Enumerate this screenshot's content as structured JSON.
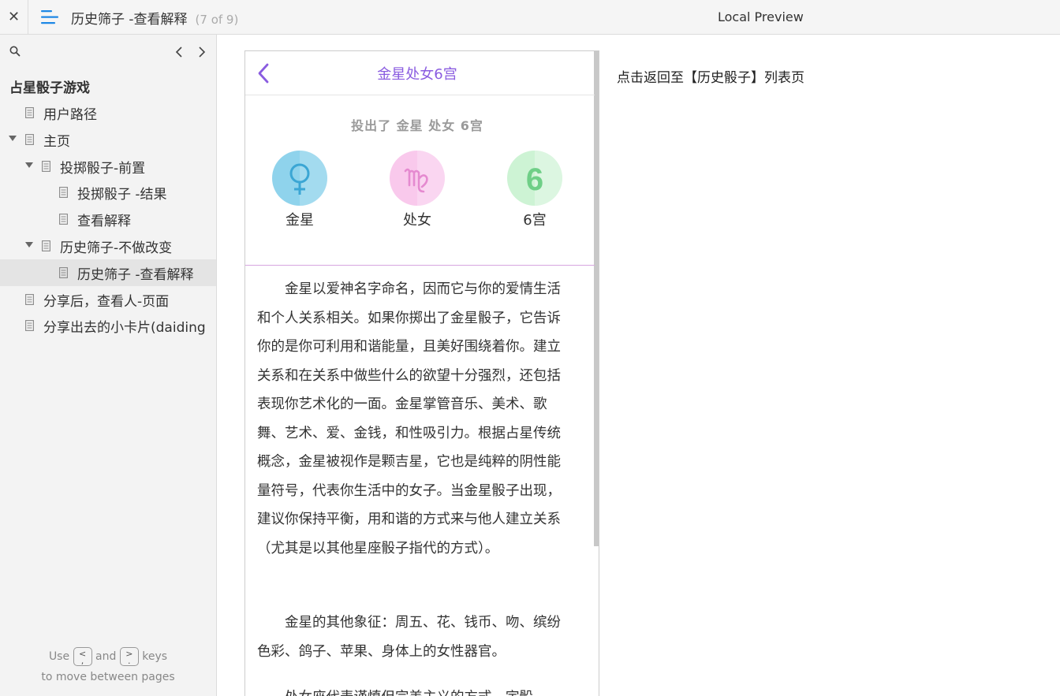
{
  "topbar": {
    "close_symbol": "✕",
    "page_title": "历史筛子 -查看解释",
    "page_count": "(7 of 9)",
    "preview_label": "Local Preview"
  },
  "sidebar": {
    "tree_title": "占星骰子游戏",
    "items": [
      {
        "label": "用户路径",
        "level": 1,
        "expanded": null,
        "selected": false
      },
      {
        "label": "主页",
        "level": 1,
        "expanded": true,
        "selected": false
      },
      {
        "label": "投掷骰子-前置",
        "level": 2,
        "expanded": true,
        "selected": false
      },
      {
        "label": "投掷骰子 -结果",
        "level": 3,
        "expanded": null,
        "selected": false
      },
      {
        "label": "查看解释",
        "level": 3,
        "expanded": null,
        "selected": false
      },
      {
        "label": "历史筛子-不做改变",
        "level": 2,
        "expanded": true,
        "selected": false
      },
      {
        "label": "历史筛子 -查看解释",
        "level": 3,
        "expanded": null,
        "selected": true
      },
      {
        "label": "分享后，查看人-页面",
        "level": 1,
        "expanded": null,
        "selected": false
      },
      {
        "label": "分享出去的小卡片(daiding",
        "level": 1,
        "expanded": null,
        "selected": false
      }
    ],
    "hint": {
      "use": "Use",
      "key_prev": "<",
      "and": "and",
      "key_next": ">",
      "keys": "keys",
      "line2": "to move between pages"
    }
  },
  "phone": {
    "title": "金星处女6宫",
    "roll_text": "投出了  金星  处女  6宫",
    "dice": [
      {
        "label": "金星",
        "symbol": "venus",
        "color": "#8fd3ec",
        "glyph_color": "#3ba6d4"
      },
      {
        "label": "处女",
        "symbol": "virgo",
        "color": "#f9c9ec",
        "glyph_color": "#e58ad0"
      },
      {
        "label": "6宫",
        "symbol": "6",
        "color": "#cdf3d4",
        "glyph_color": "#6fcf87"
      }
    ],
    "paragraphs": [
      "金星以爱神名字命名，因而它与你的爱情生活和个人关系相关。如果你掷出了金星骰子，它告诉你的是你可利用和谐能量，且美好围绕着你。建立关系和在关系中做些什么的欲望十分强烈，还包括表现你艺术化的一面。金星掌管音乐、美术、歌舞、艺术、爱、金钱，和性吸引力。根据占星传统概念，金星被视作是颗吉星，它也是纯粹的阴性能量符号，代表你生活中的女子。当金星骰子出现，建议你保持平衡，用和谐的方式来与他人建立关系（尤其是以其他星座骰子指代的方式）。",
      "金星的其他象征：周五、花、钱币、吻、缤纷色彩、鸽子、苹果、身体上的女性器官。",
      "处女座代表谨慎但完美主义的方式。宇骰"
    ]
  },
  "annotation": "点击返回至【历史骰子】列表页",
  "colors": {
    "accent": "#8a5ce0",
    "menu_icon": "#1e88e5"
  }
}
